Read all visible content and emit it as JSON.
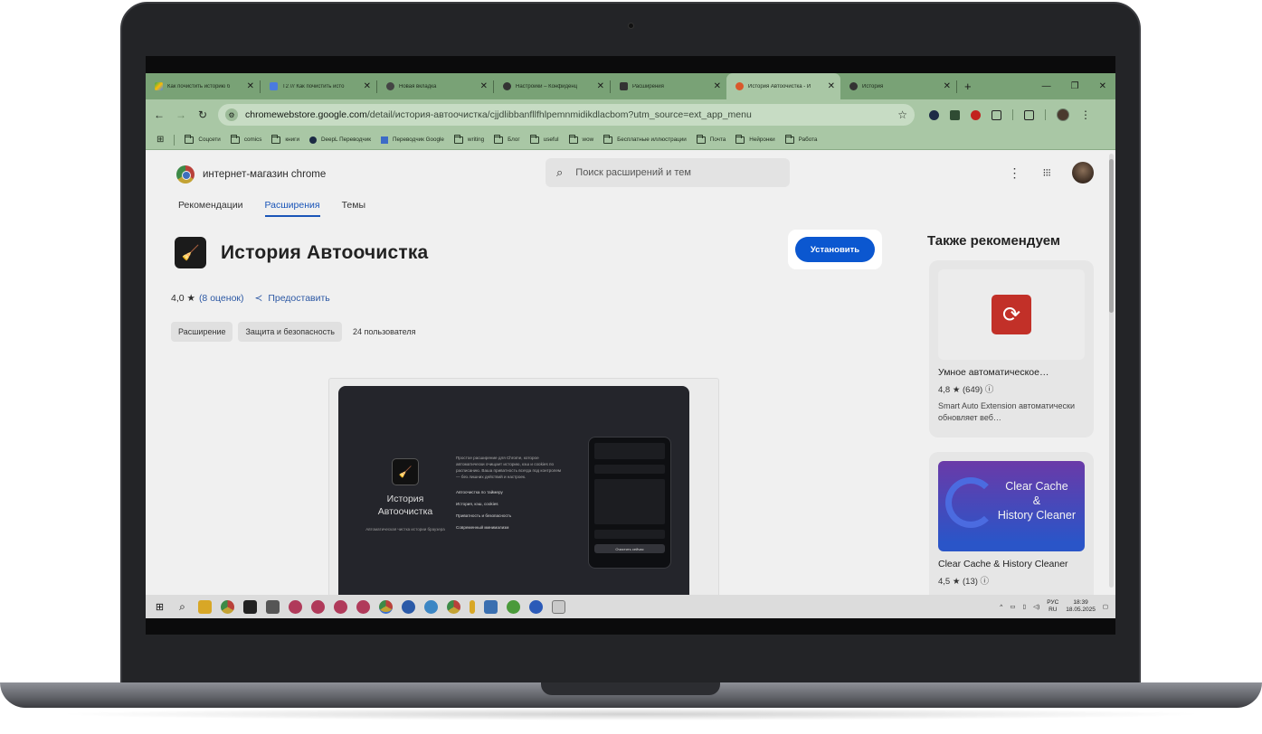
{
  "tabs": [
    {
      "title": "Как почистить историю б",
      "color": "#4285f4"
    },
    {
      "title": "T2 /// Как почистить исто",
      "color": "#4a7be0"
    },
    {
      "title": "Новая вкладка",
      "color": "#444444"
    },
    {
      "title": "Настройки – Конфиденц",
      "color": "#333333"
    },
    {
      "title": "Расширения",
      "color": "#333333"
    },
    {
      "title": "История Автоочистка - И",
      "color": "#d9582b"
    },
    {
      "title": "История",
      "color": "#333333"
    }
  ],
  "omnibox": {
    "host": "chromewebstore.google.com",
    "path": "/detail/история-автоочистка/cjjdlibbanfllfhlpemnmidikdlacbom?utm_source=ext_app_menu"
  },
  "bookmarks": [
    "Соцсети",
    "comics",
    "книги",
    "DeepL Переводчик",
    "Переводчик Google",
    "writing",
    "Блог",
    "useful",
    "wow",
    "Бесплатные иллюстрации",
    "Почта",
    "Нейронки",
    "Работа"
  ],
  "store": {
    "name": "интернет-магазин chrome",
    "search_placeholder": "Поиск расширений и тем"
  },
  "nav": {
    "recommendations": "Рекомендации",
    "extensions": "Расширения",
    "themes": "Темы"
  },
  "extension": {
    "title": "История Автоочистка",
    "install_label": "Установить",
    "rating": "4,0 ★",
    "reviews": "(8 оценок)",
    "share": "Предоставить",
    "chip_type": "Расширение",
    "chip_category": "Защита и безопасность",
    "users": "24 пользователя"
  },
  "preview": {
    "title_line1": "История",
    "title_line2": "Автоочистка",
    "subtitle": "Автоматическая чистка истории браузера",
    "description": "Простое расширение для Chrome, которое автоматически очищает историю, кэш и cookies по расписанию. Ваша приватность всегда под контролем — без лишних действий и настроек.",
    "features": [
      "Автоочистка по таймеру",
      "История, кэш, cookies",
      "Приватность и безопасность",
      "Современный минимализм"
    ],
    "phone_button": "Очистить сейчас"
  },
  "also": {
    "heading": "Также рекомендуем",
    "items": [
      {
        "name": "Умное автоматическое…",
        "rating": "4,8 ★",
        "count": "(649) ⓘ",
        "desc": "Smart Auto Extension автоматически обновляет веб…"
      },
      {
        "name": "Clear Cache & History Cleaner",
        "rating": "4,5 ★",
        "count": "(13) ⓘ",
        "thumb_line1": "Clear Cache",
        "thumb_line2": "&",
        "thumb_line3": "History Cleaner"
      }
    ]
  },
  "taskbar": {
    "lang": "РУС",
    "lang2": "RU",
    "time": "18:39",
    "date": "18.05.2025"
  }
}
